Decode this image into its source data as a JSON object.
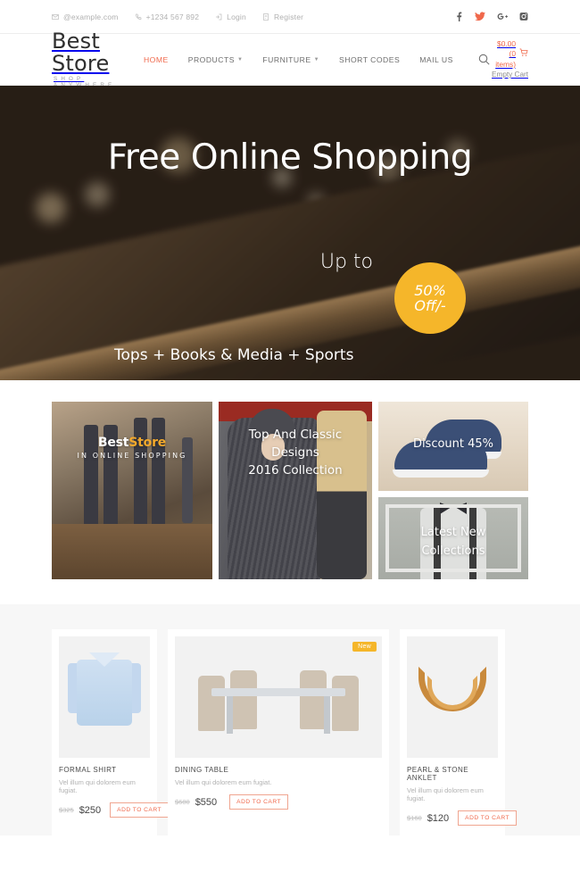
{
  "topbar": {
    "email": "@example.com",
    "phone": "+1234 567 892",
    "login": "Login",
    "register": "Register",
    "socials": [
      {
        "name": "facebook-icon",
        "color": "#5a5a5a"
      },
      {
        "name": "twitter-icon",
        "color": "#f0684b"
      },
      {
        "name": "google-plus-icon",
        "color": "#5a5a5a"
      },
      {
        "name": "instagram-icon",
        "color": "#5a5a5a"
      }
    ]
  },
  "header": {
    "logo": "Best Store",
    "tagline": "SHOP ANYWHERE",
    "nav": [
      {
        "label": "HOME",
        "active": true,
        "caret": false
      },
      {
        "label": "PRODUCTS",
        "active": false,
        "caret": true
      },
      {
        "label": "FURNITURE",
        "active": false,
        "caret": true
      },
      {
        "label": "SHORT CODES",
        "active": false,
        "caret": false
      },
      {
        "label": "MAIL US",
        "active": false,
        "caret": false
      }
    ],
    "search_icon": "search-icon",
    "cart_total": "$0.00 (0 items)",
    "cart_status": "Empty Cart",
    "accent_color": "#f0684b"
  },
  "hero": {
    "title": "Free Online Shopping",
    "upto": "Up to",
    "badge_line1": "50%",
    "badge_line2": "Off/-",
    "badge_color": "#f5b62a",
    "subtitle": "Tops + Books & Media + Sports",
    "slides": [
      {
        "active": false
      },
      {
        "active": false
      },
      {
        "active": true
      }
    ]
  },
  "promos": {
    "tile1": {
      "brand_white": "Best",
      "brand_gold": "Store",
      "sub": "IN ONLINE SHOPPING"
    },
    "tile2": {
      "label": "Discount 45%"
    },
    "tile3": {
      "line1": "Top And Classic",
      "line2": "Designs",
      "line3": "2016 Collection"
    },
    "tile4": {
      "line1": "Latest New",
      "line2": "Collections"
    }
  },
  "products": [
    {
      "title": "FORMAL SHIRT",
      "desc": "Vel illum qui dolorem eum fugiat.",
      "old_price": "$325",
      "new_price": "$250",
      "button": "ADD TO CART",
      "badge": ""
    },
    {
      "title": "DINING TABLE",
      "desc": "Vel illum qui dolorem eum fugiat.",
      "old_price": "$680",
      "new_price": "$550",
      "button": "ADD TO CART",
      "badge": "New"
    },
    {
      "title": "PEARL & STONE ANKLET",
      "desc": "Vel illum qui dolorem eum fugiat.",
      "old_price": "$160",
      "new_price": "$120",
      "button": "ADD TO CART",
      "badge": ""
    }
  ]
}
